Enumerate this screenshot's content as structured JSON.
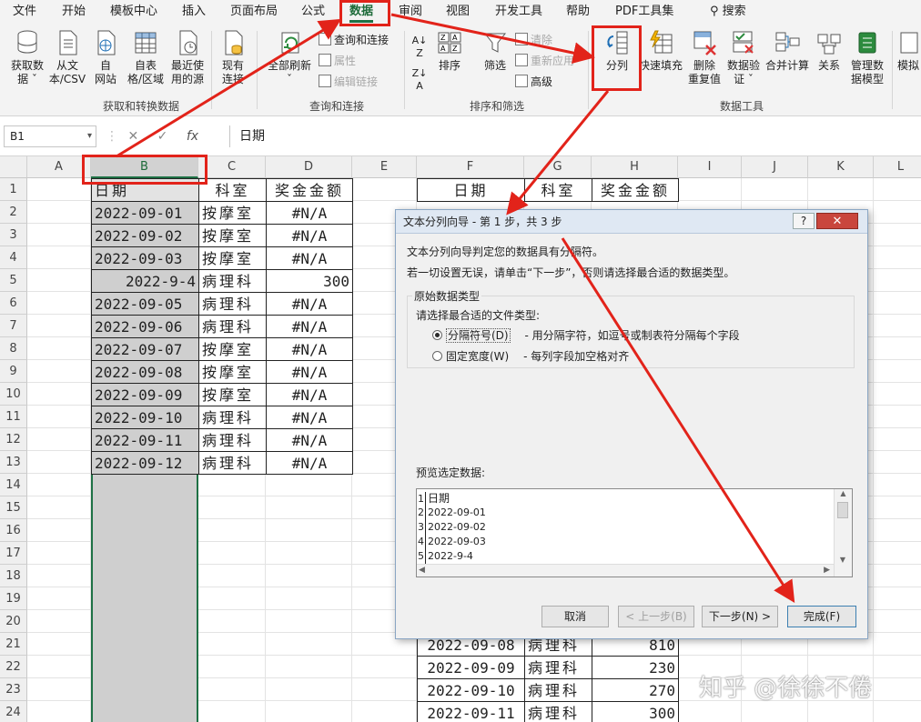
{
  "ribbon_tabs": [
    "文件",
    "开始",
    "模板中心",
    "插入",
    "页面布局",
    "公式",
    "数据",
    "审阅",
    "视图",
    "开发工具",
    "帮助",
    "PDF工具集"
  ],
  "search_label": "搜索",
  "ribbon": {
    "get_data": "获取数\n据 ˇ",
    "from_text": "从文\n本/CSV",
    "from_web": "自\n网站",
    "from_table": "自表\n格/区域",
    "recent_sources": "最近使\n用的源",
    "existing_connections": "现有\n连接",
    "refresh_all": "全部刷新\nˇ",
    "queries_connections": "查询和连接",
    "properties": "属性",
    "edit_links": "编辑链接",
    "sort": "排序",
    "filter": "筛选",
    "clear": "清除",
    "reapply": "重新应用",
    "advanced": "高级",
    "text_to_columns": "分列",
    "flash_fill": "快速填充",
    "remove_duplicates": "删除\n重复值",
    "data_validation": "数据验\n证 ˇ",
    "consolidate": "合并计算",
    "relationships": "关系",
    "manage_data_model": "管理数\n据模型",
    "simulation": "模拟",
    "group_get_transform": "获取和转换数据",
    "group_queries": "查询和连接",
    "group_sort_filter": "排序和筛选",
    "group_data_tools": "数据工具"
  },
  "formula_bar": {
    "name_box": "B1",
    "cancel": "✕",
    "confirm": "✓",
    "fx": "fx",
    "value": "日期"
  },
  "columns": [
    "A",
    "B",
    "C",
    "D",
    "E",
    "F",
    "G",
    "H",
    "I",
    "J",
    "K",
    "L"
  ],
  "rows": [
    "1",
    "2",
    "3",
    "4",
    "5",
    "6",
    "7",
    "8",
    "9",
    "10",
    "11",
    "12",
    "13",
    "14",
    "15",
    "16",
    "17",
    "18",
    "19",
    "20",
    "21",
    "22",
    "23",
    "24"
  ],
  "left_table": [
    [
      "日期",
      "科室",
      "奖金金额"
    ],
    [
      "2022-09-01",
      "按摩室",
      "#N/A"
    ],
    [
      "2022-09-02",
      "按摩室",
      "#N/A"
    ],
    [
      "2022-09-03",
      "按摩室",
      "#N/A"
    ],
    [
      "2022-9-4",
      "病理科",
      "300"
    ],
    [
      "2022-09-05",
      "病理科",
      "#N/A"
    ],
    [
      "2022-09-06",
      "病理科",
      "#N/A"
    ],
    [
      "2022-09-07",
      "按摩室",
      "#N/A"
    ],
    [
      "2022-09-08",
      "按摩室",
      "#N/A"
    ],
    [
      "2022-09-09",
      "按摩室",
      "#N/A"
    ],
    [
      "2022-09-10",
      "病理科",
      "#N/A"
    ],
    [
      "2022-09-11",
      "病理科",
      "#N/A"
    ],
    [
      "2022-09-12",
      "病理科",
      "#N/A"
    ]
  ],
  "right_table_header": [
    "日期",
    "科室",
    "奖金金额"
  ],
  "right_table_bottom": [
    [
      "2022-09-08",
      "病理科",
      "810"
    ],
    [
      "2022-09-09",
      "病理科",
      "230"
    ],
    [
      "2022-09-10",
      "病理科",
      "270"
    ],
    [
      "2022-09-11",
      "病理科",
      "300"
    ]
  ],
  "dialog": {
    "title": "文本分列向导 - 第 1 步，共 3 步",
    "help": "?",
    "close": "✕",
    "intro1": "文本分列向导判定您的数据具有分隔符。",
    "intro2": "若一切设置无误，请单击“下一步”，否则请选择最合适的数据类型。",
    "group_label": "原始数据类型",
    "choose_label": "请选择最合适的文件类型:",
    "option_delimited": "分隔符号(D)",
    "option_delimited_desc": "- 用分隔字符，如逗号或制表符分隔每个字段",
    "option_fixed": "固定宽度(W)",
    "option_fixed_desc": "- 每列字段加空格对齐",
    "preview_label": "预览选定数据:",
    "preview_rows": [
      "日期",
      "2022-09-01",
      "2022-09-02",
      "2022-09-03",
      "2022-9-4"
    ],
    "btn_cancel": "取消",
    "btn_back": "< 上一步(B)",
    "btn_next": "下一步(N) >",
    "btn_finish": "完成(F)"
  },
  "watermark": "知乎 @徐徐不倦",
  "annotation_color": "#e2231a"
}
